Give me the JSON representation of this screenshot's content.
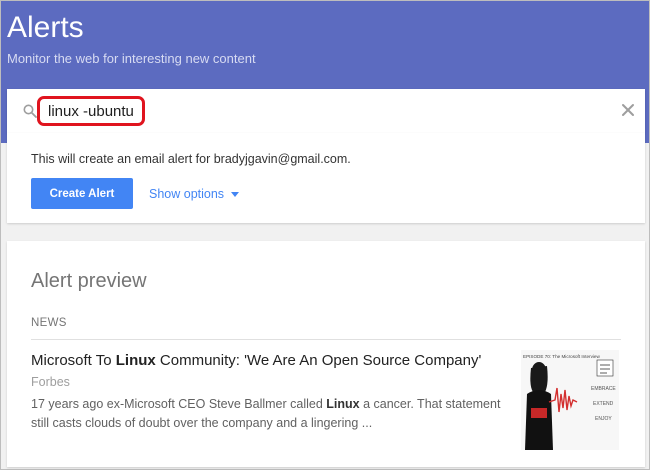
{
  "header": {
    "title": "Alerts",
    "subtitle": "Monitor the web for interesting new content",
    "background_color": "#5c6bc0"
  },
  "search": {
    "value": "linux -ubuntu",
    "search_icon": "search-icon",
    "clear_icon": "close-icon",
    "highlight_color": "#e0141e"
  },
  "create": {
    "info_text": "This will create an email alert for bradyjgavin@gmail.com.",
    "create_button_label": "Create Alert",
    "show_options_label": "Show options",
    "show_options_icon": "caret-down-icon",
    "accent_color": "#4285f4"
  },
  "preview": {
    "title": "Alert preview",
    "section_label": "NEWS",
    "article": {
      "title_before": "Microsoft To ",
      "title_bold": "Linux",
      "title_after": " Community: 'We Are An Open Source Company'",
      "source": "Forbes",
      "snippet_before": "17 years ago ex-Microsoft CEO Steve Ballmer called ",
      "snippet_bold": "Linux",
      "snippet_after": " a cancer. That statement still casts clouds of doubt over the company and a lingering ...",
      "thumbnail_caption": "EPISODE 70: The Microsoft Interview",
      "thumbnail_words": [
        "EMBRACE",
        "EXTEND",
        "ENJOY"
      ]
    }
  }
}
